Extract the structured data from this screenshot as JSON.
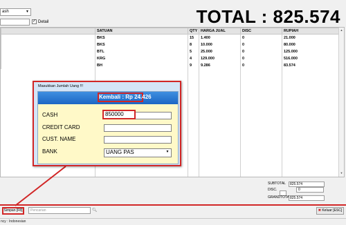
{
  "toolbar": {
    "payment_select_value": "ash",
    "detail_label": "Detail",
    "total_text": "TOTAL : 825.574"
  },
  "grid": {
    "columns": [
      "SATUAN",
      "QTY",
      "HARGA JUAL",
      "DISC",
      "RUPIAH"
    ],
    "rows": [
      {
        "satuan": "BKS",
        "qty": "15",
        "harga": "1.400",
        "disc": "0",
        "rupiah": "21.000"
      },
      {
        "satuan": "BKS",
        "qty": "8",
        "harga": "10.000",
        "disc": "0",
        "rupiah": "80.000"
      },
      {
        "satuan": "BTL",
        "qty": "5",
        "harga": "25.000",
        "disc": "0",
        "rupiah": "125.000"
      },
      {
        "satuan": "KRG",
        "qty": "4",
        "harga": "129.000",
        "disc": "0",
        "rupiah": "516.000"
      },
      {
        "satuan": "BH",
        "qty": "9",
        "harga": "9.286",
        "disc": "0",
        "rupiah": "83.574"
      }
    ]
  },
  "summary": {
    "subtotal_label": "SUBTOTAL",
    "subtotal_value": "825.574",
    "disc_label": "DISC.",
    "disc_value": "0",
    "grandtotal_label": "GRANDTOTAL",
    "grandtotal_value": "825.574"
  },
  "bottom": {
    "simpan_label": "Simpan [F8]",
    "note_placeholder": "Pencarian",
    "keluar_label": "Keluar [ESC]"
  },
  "status": {
    "text": "ncy : Indonesian"
  },
  "dialog": {
    "title": "Masukkan Jumlah Uang !!!",
    "kembali_text": "Kembali : Rp 24.426",
    "cash_label": "CASH",
    "cash_value": "850000",
    "credit_label": "CREDIT CARD",
    "credit_value": "",
    "custname_label": "CUST. NAME",
    "custname_value": "",
    "bank_label": "BANK",
    "bank_value": "UANG PAS"
  },
  "colors": {
    "highlight_red": "#d12626",
    "banner_blue": "#2a78d6",
    "panel_yellow": "#fff9c8"
  }
}
